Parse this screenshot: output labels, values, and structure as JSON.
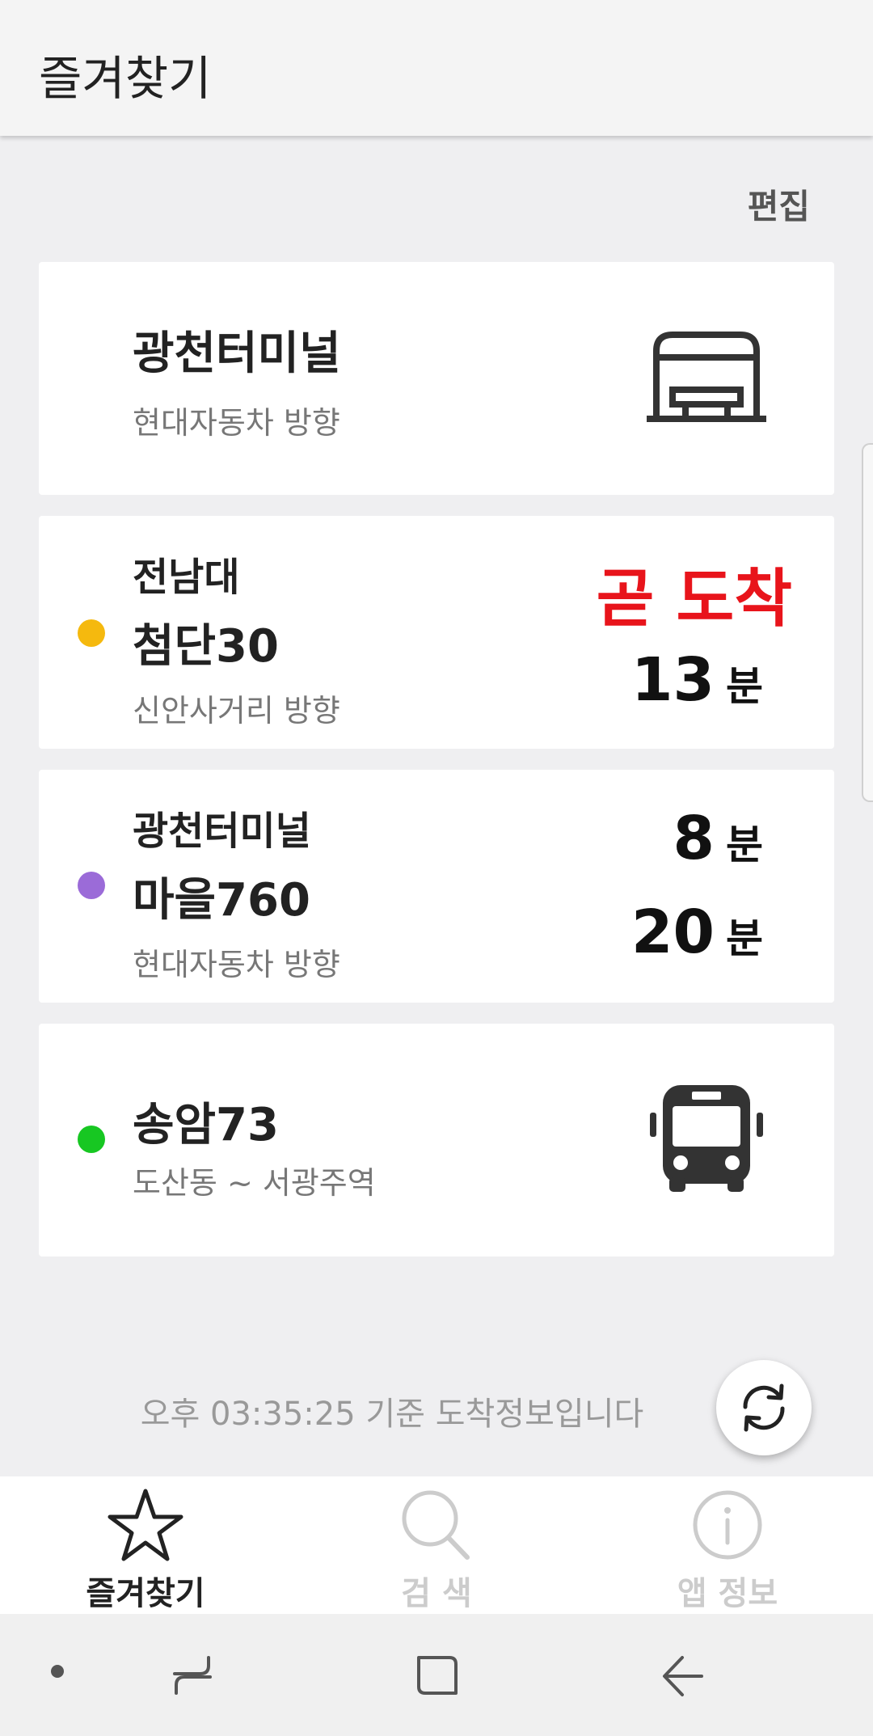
{
  "appbar": {
    "title": "즐겨찾기"
  },
  "edit_label": "편집",
  "favorites": {
    "stop": {
      "name": "광천터미널",
      "direction": "현대자동차 방향",
      "icon": "bus-stop-icon"
    },
    "route1": {
      "stop": "전남대",
      "route": "첨단30",
      "direction": "신안사거리 방향",
      "dot_color": "#f5b90e",
      "first_arrival": "곧 도착",
      "first_color": "#e8141b",
      "second_num": "13",
      "second_unit": "분"
    },
    "route2": {
      "stop": "광천터미널",
      "route": "마을760",
      "direction": "현대자동차 방향",
      "dot_color": "#9b6bd8",
      "first_num": "8",
      "first_unit": "분",
      "second_num": "20",
      "second_unit": "분"
    },
    "route3": {
      "route": "송암73",
      "direction": "도산동 ~ 서광주역",
      "dot_color": "#17c722",
      "icon": "bus-icon"
    }
  },
  "update_text": "오후 03:35:25 기준 도착정보입니다",
  "refresh_icon": "refresh-icon",
  "bottom_nav": [
    {
      "label": "즐겨찾기",
      "icon": "star-icon",
      "active": true
    },
    {
      "label": "검  색",
      "icon": "search-icon",
      "active": false
    },
    {
      "label": "앱 정보",
      "icon": "info-icon",
      "active": false
    }
  ],
  "colors": {
    "active": "#222222",
    "inactive": "#cccccc",
    "accent_red": "#e8141b"
  }
}
